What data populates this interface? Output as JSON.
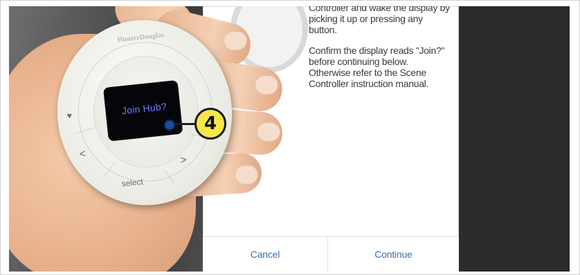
{
  "phone": {
    "instructions": [
      "Controller and wake the display by picking it up or pressing any button.",
      "Confirm the display reads \"Join?\" before continuing below. Otherwise refer to the Scene Controller instruction manual."
    ],
    "cancel_label": "Cancel",
    "continue_label": "Continue"
  },
  "controller": {
    "brand": "HunterDouglas",
    "screen_text": "Join Hub?",
    "heart_symbol": "♥",
    "left_symbol": "<",
    "select_label": "select",
    "right_symbol": ">",
    "hearts_symbol": "♥♥"
  },
  "callout": {
    "number": "4"
  },
  "colors": {
    "callout_fill": "#f6e84a",
    "screen_text": "#6f7cff",
    "phone_button_text": "#3a6fa5"
  }
}
